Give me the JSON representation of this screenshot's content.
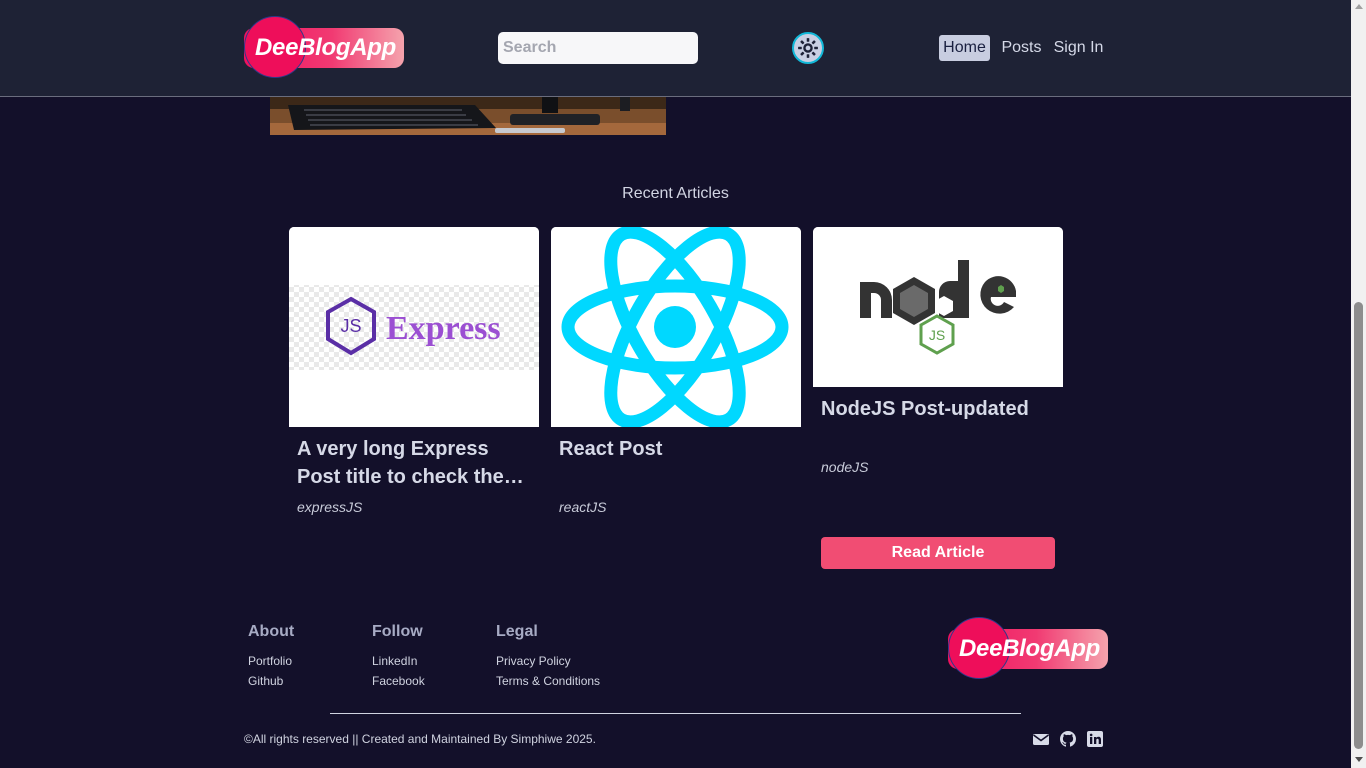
{
  "header": {
    "logo_text": "DeeBlogApp",
    "search_placeholder": "Search",
    "nav": [
      {
        "label": "Home",
        "active": true
      },
      {
        "label": "Posts",
        "active": false
      },
      {
        "label": "Sign In",
        "active": false
      }
    ]
  },
  "recent": {
    "heading": "Recent Articles",
    "cards": [
      {
        "title": "A very long Express Post title to check the text overflow",
        "tag": "expressJS",
        "image_text": "Express",
        "image_badge": "JS"
      },
      {
        "title": "React Post",
        "tag": "reactJS"
      },
      {
        "title": "NodeJS Post-updated",
        "tag": "nodeJS",
        "button": "Read Article",
        "image_badge": "JS"
      }
    ]
  },
  "footer": {
    "columns": [
      {
        "title": "About",
        "links": [
          "Portfolio",
          "Github"
        ]
      },
      {
        "title": "Follow",
        "links": [
          "LinkedIn",
          "Facebook"
        ]
      },
      {
        "title": "Legal",
        "links": [
          "Privacy Policy",
          "Terms & Conditions"
        ]
      }
    ],
    "logo_text": "DeeBlogApp",
    "copyright": "©All rights reserved || Created and Maintained By Simphiwe 2025.",
    "social_icons": [
      "mail-icon",
      "github-icon",
      "linkedin-icon"
    ]
  },
  "colors": {
    "background": "#13102a",
    "header_bg": "#1e2235",
    "accent": "#f14d73",
    "react_cyan": "#00d8ff",
    "express_purple": "#9b4fd2",
    "node_green": "#5fa04e"
  }
}
